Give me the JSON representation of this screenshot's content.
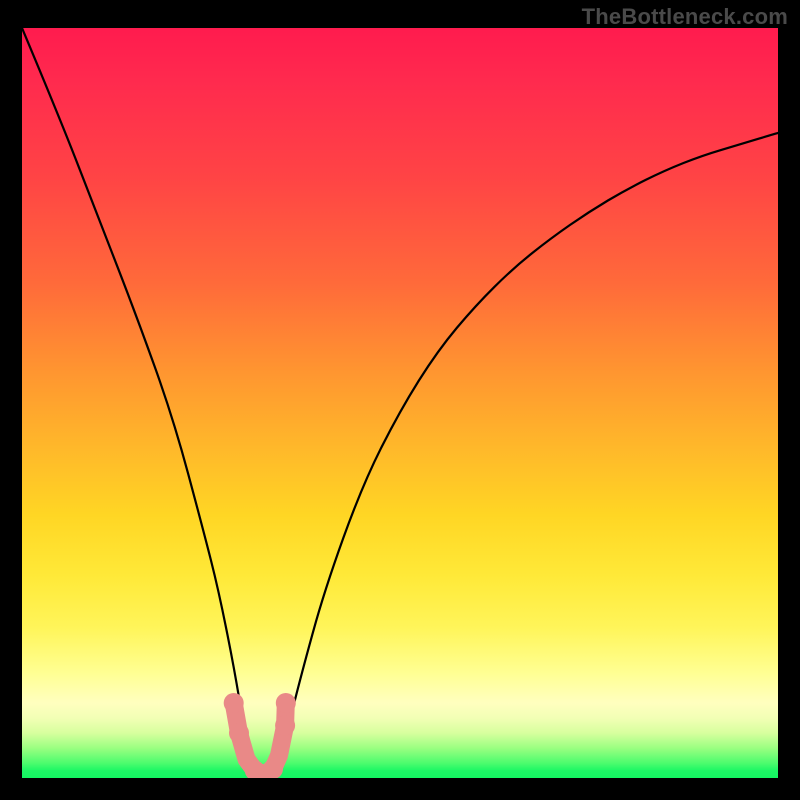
{
  "watermark": "TheBottleneck.com",
  "chart_data": {
    "type": "line",
    "title": "",
    "xlabel": "",
    "ylabel": "",
    "xlim": [
      0,
      100
    ],
    "ylim": [
      0,
      100
    ],
    "grid": false,
    "legend": null,
    "background_gradient_vertical": {
      "stops": [
        {
          "pos": 0,
          "color": "#ff1b4e",
          "meaning": "high"
        },
        {
          "pos": 50,
          "color": "#ff9630",
          "meaning": "mid-high"
        },
        {
          "pos": 80,
          "color": "#fff55a",
          "meaning": "mid-low"
        },
        {
          "pos": 100,
          "color": "#14f562",
          "meaning": "low"
        }
      ]
    },
    "series": [
      {
        "name": "bottleneck-curve",
        "x": [
          0,
          5,
          10,
          15,
          20,
          24,
          26,
          28,
          29.5,
          30.5,
          32,
          33.5,
          35,
          37,
          40,
          45,
          50,
          55,
          60,
          65,
          70,
          75,
          80,
          85,
          90,
          95,
          100
        ],
        "y": [
          100,
          88,
          75,
          62,
          48,
          33,
          25,
          15,
          6,
          1,
          0,
          1,
          6,
          14,
          25,
          39,
          49,
          57,
          63,
          68,
          72,
          75.5,
          78.5,
          81,
          83,
          84.5,
          86
        ],
        "notes": "y is percentage height of the plotted curve relative to plot area; minimum (≈0) occurs near x≈32."
      }
    ],
    "markers": {
      "cluster_near_minimum": {
        "color": "#e98987",
        "approximate_points_xy": [
          [
            28.0,
            10
          ],
          [
            28.7,
            6
          ],
          [
            29.7,
            2.5
          ],
          [
            30.8,
            1
          ],
          [
            32.0,
            0.5
          ],
          [
            33.2,
            1.2
          ],
          [
            34.0,
            3
          ],
          [
            34.8,
            7
          ],
          [
            34.9,
            10
          ]
        ]
      }
    }
  }
}
